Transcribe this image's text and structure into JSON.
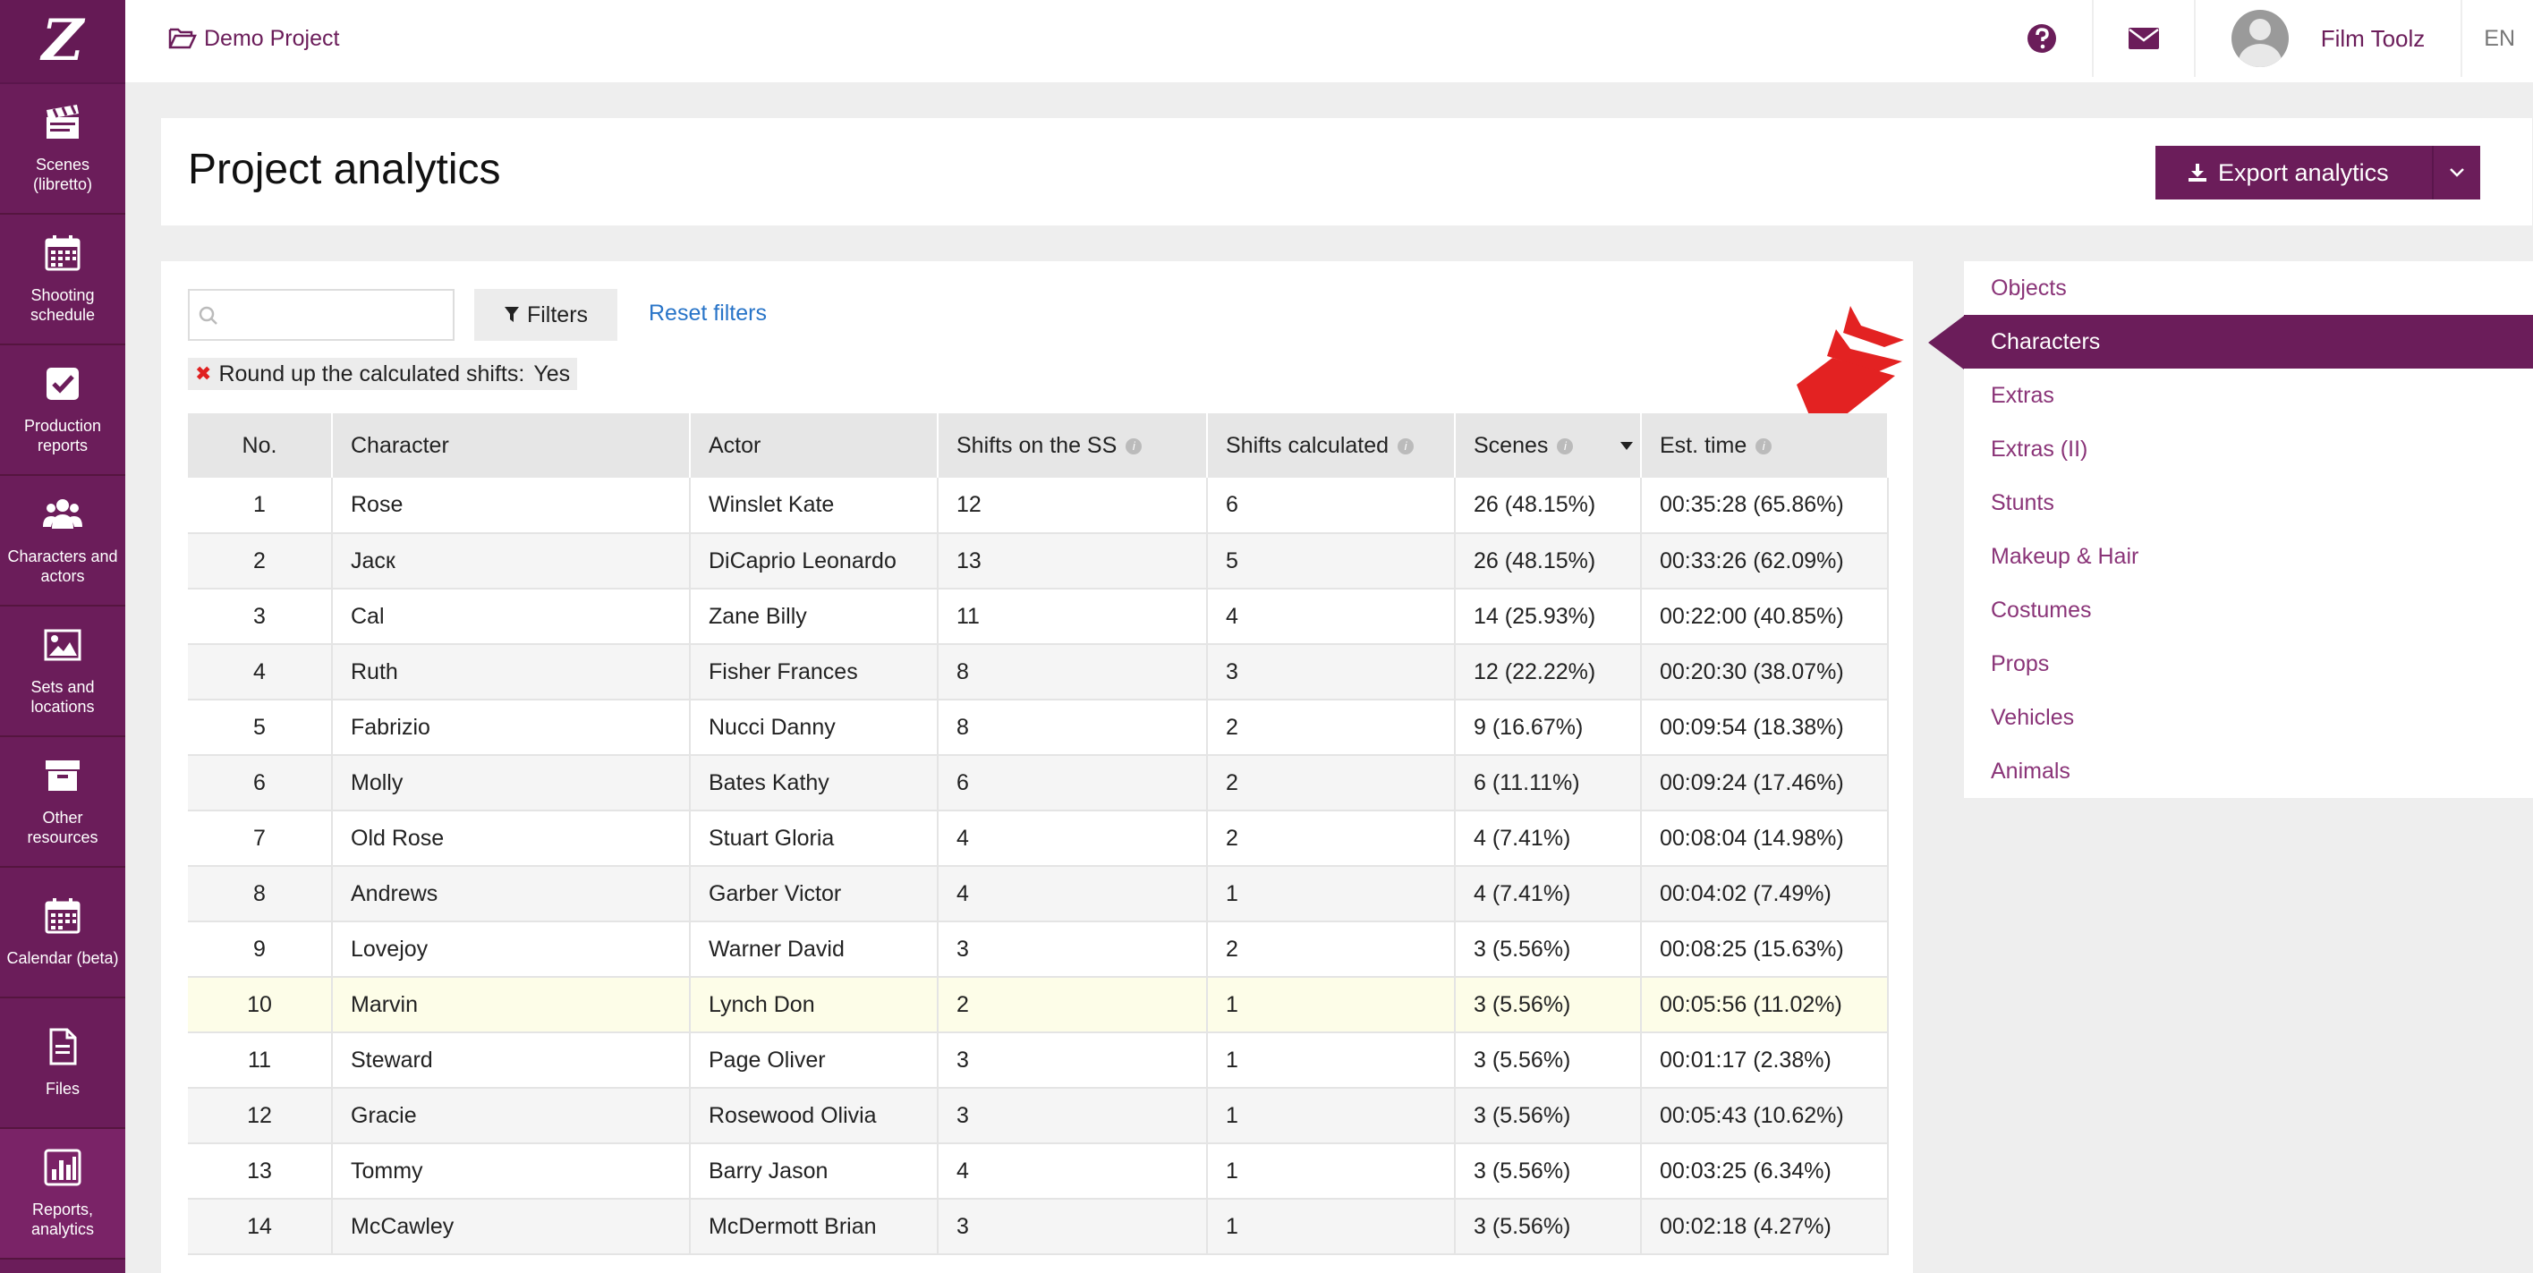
{
  "app": {
    "logo": "Z"
  },
  "sidebar": {
    "items": [
      {
        "label": "Scenes (libretto)",
        "icon": "clapperboard-icon"
      },
      {
        "label": "Shooting schedule",
        "icon": "calendar-icon"
      },
      {
        "label": "Production reports",
        "icon": "checkbox-icon"
      },
      {
        "label": "Characters and actors",
        "icon": "users-icon"
      },
      {
        "label": "Sets and locations",
        "icon": "image-icon"
      },
      {
        "label": "Other resources",
        "icon": "archive-box-icon"
      },
      {
        "label": "Calendar (beta)",
        "icon": "calendar-icon"
      },
      {
        "label": "Files",
        "icon": "file-icon"
      },
      {
        "label": "Reports, analytics",
        "icon": "bar-chart-icon"
      }
    ]
  },
  "topbar": {
    "project": "Demo Project",
    "username": "Film Toolz",
    "language": "EN"
  },
  "header": {
    "title": "Project analytics",
    "export_label": "Export analytics"
  },
  "filters": {
    "search_placeholder": "",
    "filters_label": "Filters",
    "reset_label": "Reset filters",
    "chip_label": "Round up the calculated shifts:",
    "chip_value": "Yes"
  },
  "table": {
    "columns": [
      "No.",
      "Character",
      "Actor",
      "Shifts on the SS",
      "Shifts calculated",
      "Scenes",
      "Est. time"
    ],
    "rows": [
      [
        "1",
        "Rose",
        "Winslet Kate",
        "12",
        "6",
        "26 (48.15%)",
        "00:35:28 (65.86%)"
      ],
      [
        "2",
        "Jacк",
        "DiCaprio Leonardo",
        "13",
        "5",
        "26 (48.15%)",
        "00:33:26 (62.09%)"
      ],
      [
        "3",
        "Cal",
        "Zane Billy",
        "11",
        "4",
        "14 (25.93%)",
        "00:22:00 (40.85%)"
      ],
      [
        "4",
        "Ruth",
        "Fisher Frances",
        "8",
        "3",
        "12 (22.22%)",
        "00:20:30 (38.07%)"
      ],
      [
        "5",
        "Fabrizio",
        "Nucci Danny",
        "8",
        "2",
        "9 (16.67%)",
        "00:09:54 (18.38%)"
      ],
      [
        "6",
        "Molly",
        "Bates Kathy",
        "6",
        "2",
        "6 (11.11%)",
        "00:09:24 (17.46%)"
      ],
      [
        "7",
        "Old Rose",
        "Stuart Gloria",
        "4",
        "2",
        "4 (7.41%)",
        "00:08:04 (14.98%)"
      ],
      [
        "8",
        "Andrews",
        "Garber Victor",
        "4",
        "1",
        "4 (7.41%)",
        "00:04:02 (7.49%)"
      ],
      [
        "9",
        "Lovejoy",
        "Warner David",
        "3",
        "2",
        "3 (5.56%)",
        "00:08:25 (15.63%)"
      ],
      [
        "10",
        "Marvin",
        "Lynch Don",
        "2",
        "1",
        "3 (5.56%)",
        "00:05:56 (11.02%)"
      ],
      [
        "11",
        "Steward",
        "Page Oliver",
        "3",
        "1",
        "3 (5.56%)",
        "00:01:17 (2.38%)"
      ],
      [
        "12",
        "Gracie",
        "Rosewood Olivia",
        "3",
        "1",
        "3 (5.56%)",
        "00:05:43 (10.62%)"
      ],
      [
        "13",
        "Tommy",
        "Barry Jason",
        "4",
        "1",
        "3 (5.56%)",
        "00:03:25 (6.34%)"
      ],
      [
        "14",
        "McCawley",
        "McDermott Brian",
        "3",
        "1",
        "3 (5.56%)",
        "00:02:18 (4.27%)"
      ]
    ]
  },
  "right_panel": {
    "items": [
      "Objects",
      "Characters",
      "Extras",
      "Extras (II)",
      "Stunts",
      "Makeup & Hair",
      "Costumes",
      "Props",
      "Vehicles",
      "Animals"
    ],
    "active": "Characters"
  },
  "colors": {
    "brand": "#6b1d5a",
    "link": "#2874c8",
    "highlight_row": "#fdfde8",
    "chip_remove": "#e02020"
  }
}
